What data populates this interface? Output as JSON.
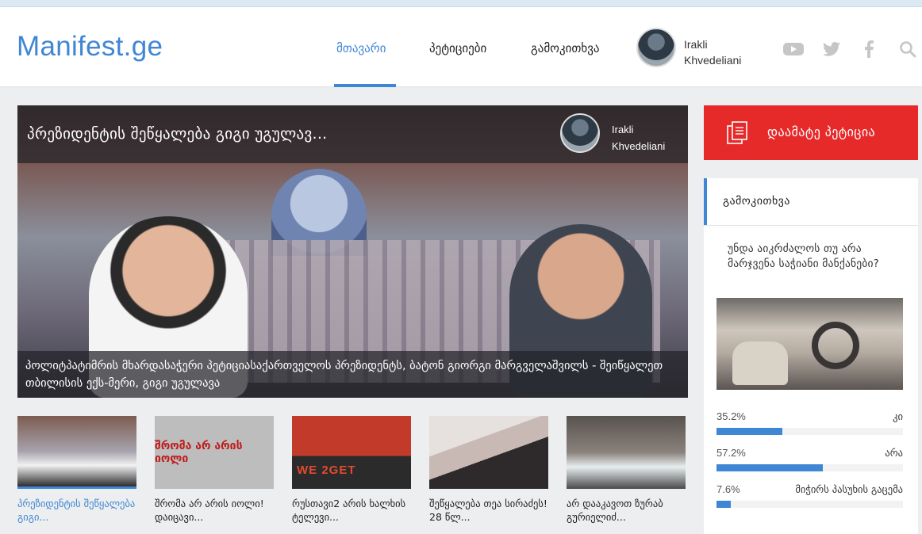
{
  "header": {
    "logo": "Manifest.ge",
    "nav": [
      {
        "label": "მთავარი",
        "active": true
      },
      {
        "label": "პეტიციები",
        "active": false
      },
      {
        "label": "გამოკითხვა",
        "active": false
      }
    ],
    "user": {
      "name_line1": "Irakli",
      "name_line2": "Khvedeliani"
    },
    "social_icons": [
      "youtube-icon",
      "twitter-icon",
      "facebook-icon",
      "search-icon"
    ]
  },
  "hero": {
    "title": "პრეზიდენტის შეწყალება გიგი უგულავ...",
    "author_line1": "Irakli",
    "author_line2": "Khvedeliani",
    "caption": "პოლიტპატიმრის მხარდასაჭერი პეტიციასაქართველოს პრეზიდენტს, ბატონ გიორგი მარგველაშვილს  -  შეიწყალეთ თბილისის ექს-მერი, გიგი უგულავა"
  },
  "thumbs": [
    {
      "title": "პრეზიდენტის შეწყალება გიგი...",
      "active": true
    },
    {
      "title": "შრომა არ არის იოლი! დაიცავი...",
      "image_text": "შრომა არ არის იოლი",
      "active": false
    },
    {
      "title": "რუსთავი2 არის ხალხის ტელევი...",
      "image_text": "WE  2GET",
      "active": false
    },
    {
      "title": "შეწყალება თეა სირაძეს! 28 წლ...",
      "active": false
    },
    {
      "title": "არ დააკავოთ ზურაბ გურიელიძ...",
      "active": false
    }
  ],
  "sidebar": {
    "add_petition_label": "დაამატე პეტიცია"
  },
  "poll": {
    "heading": "გამოკითხვა",
    "question": "უნდა აიკრძალოს თუ არა მარჯვენა საჭიანი მანქანები?",
    "options": [
      {
        "percent_label": "35.2%",
        "label": "კი",
        "value": 35.2
      },
      {
        "percent_label": "57.2%",
        "label": "არა",
        "value": 57.2
      },
      {
        "percent_label": "7.6%",
        "label": "მიჭირს პასუხის გაცემა",
        "value": 7.6
      }
    ]
  },
  "colors": {
    "accent": "#3f86d4",
    "cta": "#e62a2a"
  }
}
